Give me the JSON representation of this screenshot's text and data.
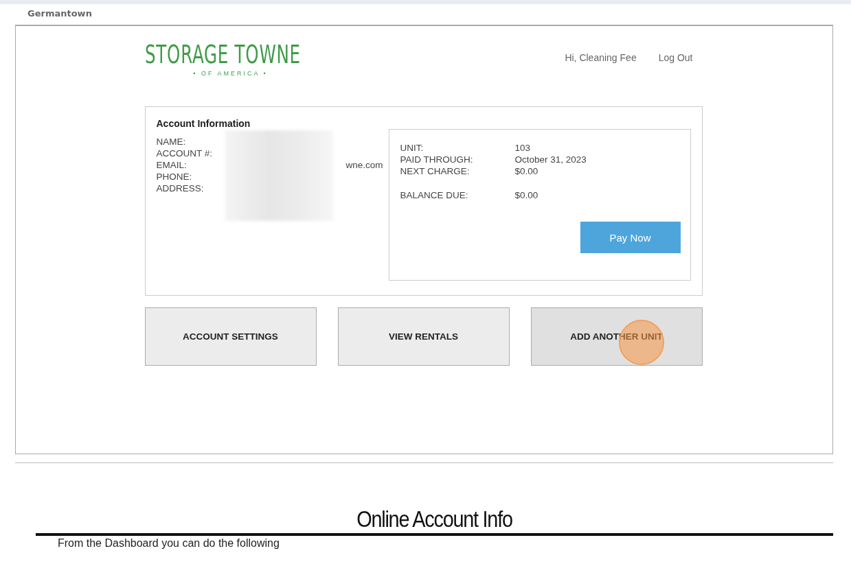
{
  "location": "Germantown",
  "logo": {
    "name": "STORAGE TOWNE",
    "tagline": "• OF AMERICA •"
  },
  "header_links": [
    {
      "label": "Hi, Cleaning Fee"
    },
    {
      "label": "Log Out"
    }
  ],
  "account": {
    "title": "Account Information",
    "fields": [
      {
        "label": "NAME:"
      },
      {
        "label": "ACCOUNT #:"
      },
      {
        "label": "EMAIL:",
        "value": "wne.com"
      },
      {
        "label": "PHONE:"
      },
      {
        "label": "ADDRESS:"
      }
    ],
    "redacted": true
  },
  "unit": {
    "rows": [
      {
        "label": "UNIT:",
        "value": "103"
      },
      {
        "label": "PAID THROUGH:",
        "value": "October 31, 2023"
      },
      {
        "label": "NEXT CHARGE:",
        "value": "$0.00"
      }
    ],
    "balance": {
      "label": "BALANCE DUE:",
      "value": "$0.00"
    },
    "pay_button": "Pay Now"
  },
  "actions": [
    {
      "label": "ACCOUNT SETTINGS",
      "hovered": false
    },
    {
      "label": "VIEW RENTALS",
      "hovered": false
    },
    {
      "label": "ADD ANOTHER UNIT",
      "hovered": true
    }
  ],
  "heading": "Online Account Info",
  "intro": "From the Dashboard you can do the following"
}
